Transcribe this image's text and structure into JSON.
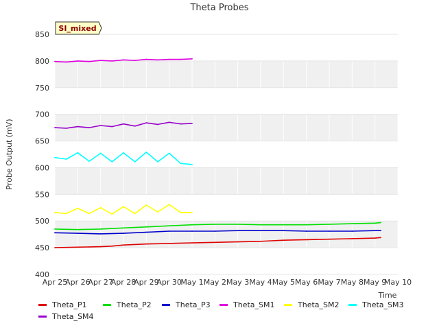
{
  "chart_data": {
    "type": "line",
    "title": "Theta Probes",
    "xlabel": "Time",
    "ylabel": "Probe Output (mV)",
    "ylim": [
      400,
      850
    ],
    "yticks": [
      400,
      450,
      500,
      550,
      600,
      650,
      700,
      750,
      800,
      850
    ],
    "xlim": [
      "2024-04-25",
      "2024-05-10"
    ],
    "xtick_labels": [
      "Apr 25",
      "Apr 26",
      "Apr 27",
      "Apr 28",
      "Apr 29",
      "Apr 30",
      "May 1",
      "May 2",
      "May 3",
      "May 4",
      "May 5",
      "May 6",
      "May 7",
      "May 8",
      "May 9",
      "May 10"
    ],
    "badge": "SI_mixed",
    "legend_position": "bottom",
    "grid": true,
    "series": [
      {
        "name": "Theta_P1",
        "color": "#e00000",
        "x": [
          "2024-04-25",
          "2024-04-26",
          "2024-04-27",
          "2024-04-27 12:00",
          "2024-04-28",
          "2024-04-29",
          "2024-04-30",
          "2024-05-01",
          "2024-05-02",
          "2024-05-03",
          "2024-05-04",
          "2024-05-05",
          "2024-05-06",
          "2024-05-07",
          "2024-05-08",
          "2024-05-09",
          "2024-05-09 06:00"
        ],
        "values": [
          450,
          451,
          452,
          453,
          455,
          457,
          458,
          459,
          460,
          461,
          462,
          464,
          465,
          466,
          467,
          468,
          469
        ]
      },
      {
        "name": "Theta_P2",
        "color": "#00e000",
        "x": [
          "2024-04-25",
          "2024-04-26",
          "2024-04-27",
          "2024-04-28",
          "2024-04-29",
          "2024-04-30",
          "2024-05-01",
          "2024-05-02",
          "2024-05-03",
          "2024-05-04",
          "2024-05-05",
          "2024-05-06",
          "2024-05-07",
          "2024-05-08",
          "2024-05-09",
          "2024-05-09 06:00"
        ],
        "values": [
          485,
          484,
          485,
          487,
          489,
          491,
          493,
          494,
          494,
          493,
          493,
          493,
          494,
          495,
          496,
          497
        ]
      },
      {
        "name": "Theta_P3",
        "color": "#0000cc",
        "x": [
          "2024-04-25",
          "2024-04-26",
          "2024-04-27",
          "2024-04-28",
          "2024-04-29",
          "2024-04-30",
          "2024-05-01",
          "2024-05-02",
          "2024-05-03",
          "2024-05-04",
          "2024-05-05",
          "2024-05-06",
          "2024-05-07",
          "2024-05-08",
          "2024-05-09",
          "2024-05-09 06:00"
        ],
        "values": [
          478,
          477,
          476,
          477,
          479,
          481,
          481,
          481,
          482,
          482,
          482,
          481,
          481,
          481,
          482,
          482
        ]
      },
      {
        "name": "Theta_SM1",
        "color": "#e000e0",
        "x": [
          "2024-04-25",
          "2024-04-25 12:00",
          "2024-04-26",
          "2024-04-26 12:00",
          "2024-04-27",
          "2024-04-27 12:00",
          "2024-04-28",
          "2024-04-28 12:00",
          "2024-04-29",
          "2024-04-29 12:00",
          "2024-04-30",
          "2024-04-30 12:00",
          "2024-05-01"
        ],
        "values": [
          799,
          798,
          800,
          799,
          801,
          800,
          802,
          801,
          803,
          802,
          803,
          803,
          804
        ]
      },
      {
        "name": "Theta_SM2",
        "color": "#ffff00",
        "x": [
          "2024-04-25",
          "2024-04-25 12:00",
          "2024-04-26",
          "2024-04-26 12:00",
          "2024-04-27",
          "2024-04-27 12:00",
          "2024-04-28",
          "2024-04-28 12:00",
          "2024-04-29",
          "2024-04-29 12:00",
          "2024-04-30",
          "2024-04-30 12:00",
          "2024-05-01"
        ],
        "values": [
          516,
          514,
          524,
          514,
          525,
          513,
          527,
          514,
          530,
          517,
          531,
          516,
          516
        ]
      },
      {
        "name": "Theta_SM3",
        "color": "#00ffff",
        "x": [
          "2024-04-25",
          "2024-04-25 12:00",
          "2024-04-26",
          "2024-04-26 12:00",
          "2024-04-27",
          "2024-04-27 12:00",
          "2024-04-28",
          "2024-04-28 12:00",
          "2024-04-29",
          "2024-04-29 12:00",
          "2024-04-30",
          "2024-04-30 12:00",
          "2024-05-01"
        ],
        "values": [
          619,
          616,
          628,
          612,
          627,
          611,
          628,
          611,
          629,
          611,
          627,
          608,
          606
        ]
      },
      {
        "name": "Theta_SM4",
        "color": "#9900cc",
        "x": [
          "2024-04-25",
          "2024-04-25 12:00",
          "2024-04-26",
          "2024-04-26 12:00",
          "2024-04-27",
          "2024-04-27 12:00",
          "2024-04-28",
          "2024-04-28 12:00",
          "2024-04-29",
          "2024-04-29 12:00",
          "2024-04-30",
          "2024-04-30 12:00",
          "2024-05-01"
        ],
        "values": [
          675,
          674,
          677,
          675,
          679,
          677,
          682,
          678,
          684,
          681,
          685,
          682,
          683
        ]
      }
    ]
  }
}
